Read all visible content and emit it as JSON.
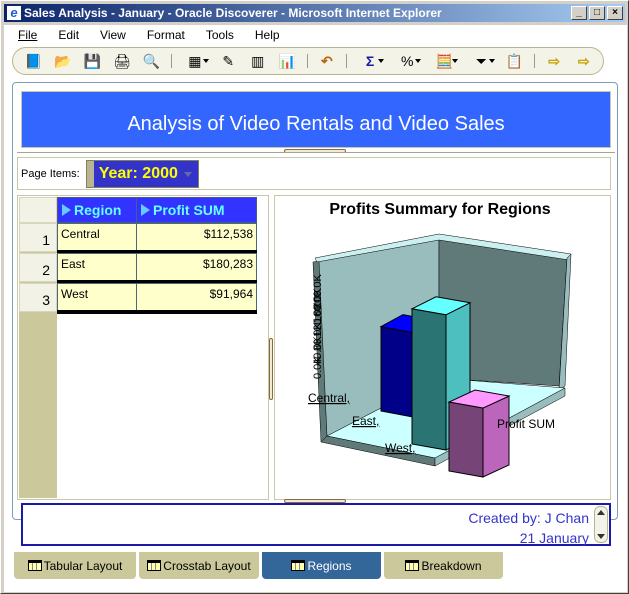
{
  "window": {
    "title": "Sales Analysis - January - Oracle  Discoverer - Microsoft Internet Explorer",
    "controls": [
      "_",
      "□",
      "×"
    ]
  },
  "menu": [
    {
      "label": "File",
      "accel": "F"
    },
    {
      "label": "Edit",
      "accel": "E"
    },
    {
      "label": "View",
      "accel": "V"
    },
    {
      "label": "Format",
      "accel": "o"
    },
    {
      "label": "Tools",
      "accel": "T"
    },
    {
      "label": "Help",
      "accel": "H"
    }
  ],
  "toolbar": {
    "icons": [
      "new-workbook-icon",
      "open-workbook-icon",
      "save-icon",
      "print-icon",
      "print-preview-icon",
      "new-sheet-icon",
      "edit-sheet-icon",
      "table-icon",
      "graph-icon",
      "undo-icon",
      "totals-icon",
      "percentages-icon",
      "calculations-icon",
      "filters-icon",
      "conditional-format-icon",
      "export-icon",
      "send-icon"
    ],
    "glyphs": [
      "📘",
      "📂",
      "💾",
      "🖨",
      "🔍",
      "▦",
      "✎",
      "▥",
      "📊",
      "↶",
      "Σ",
      "%",
      "🧮",
      "⏷",
      "📋",
      "⇨",
      "⇨"
    ]
  },
  "banner": {
    "title": "Analysis of Video Rentals and Video Sales",
    "bg": "#3366ff"
  },
  "page_items": {
    "label": "Page Items:",
    "selected": "Year: 2000"
  },
  "table": {
    "columns": [
      "Region",
      "Profit SUM"
    ],
    "rows": [
      {
        "num": "1",
        "region": "Central",
        "profit": "$112,538"
      },
      {
        "num": "2",
        "region": "East",
        "profit": "$180,283"
      },
      {
        "num": "3",
        "region": "West",
        "profit": "$91,964"
      }
    ]
  },
  "chart_data": {
    "type": "bar",
    "style": "3d",
    "title": "Profits Summary for Regions",
    "categories": [
      "Central",
      "East",
      "West"
    ],
    "category_labels": [
      "Central,",
      "East,",
      "West,"
    ],
    "series": [
      {
        "name": "Profit SUM",
        "values": [
          112538,
          180283,
          91964
        ]
      }
    ],
    "series_colors": [
      "#0000cc",
      "#33aaaa",
      "#cc66cc"
    ],
    "ylabel": "",
    "ytick_labels": [
      "0.0K",
      "40.0K",
      "80.0K",
      "120.0K",
      "160.0K",
      "200.0K"
    ],
    "ylim": [
      0,
      200000
    ],
    "legend": "none"
  },
  "footer": {
    "line1": "Created by: J Chan",
    "line2": "21 January"
  },
  "tabs": [
    {
      "label": "Tabular Layout",
      "active": false
    },
    {
      "label": "Crosstab Layout",
      "active": false
    },
    {
      "label": "Regions",
      "active": true
    },
    {
      "label": "Breakdown",
      "active": false
    }
  ]
}
